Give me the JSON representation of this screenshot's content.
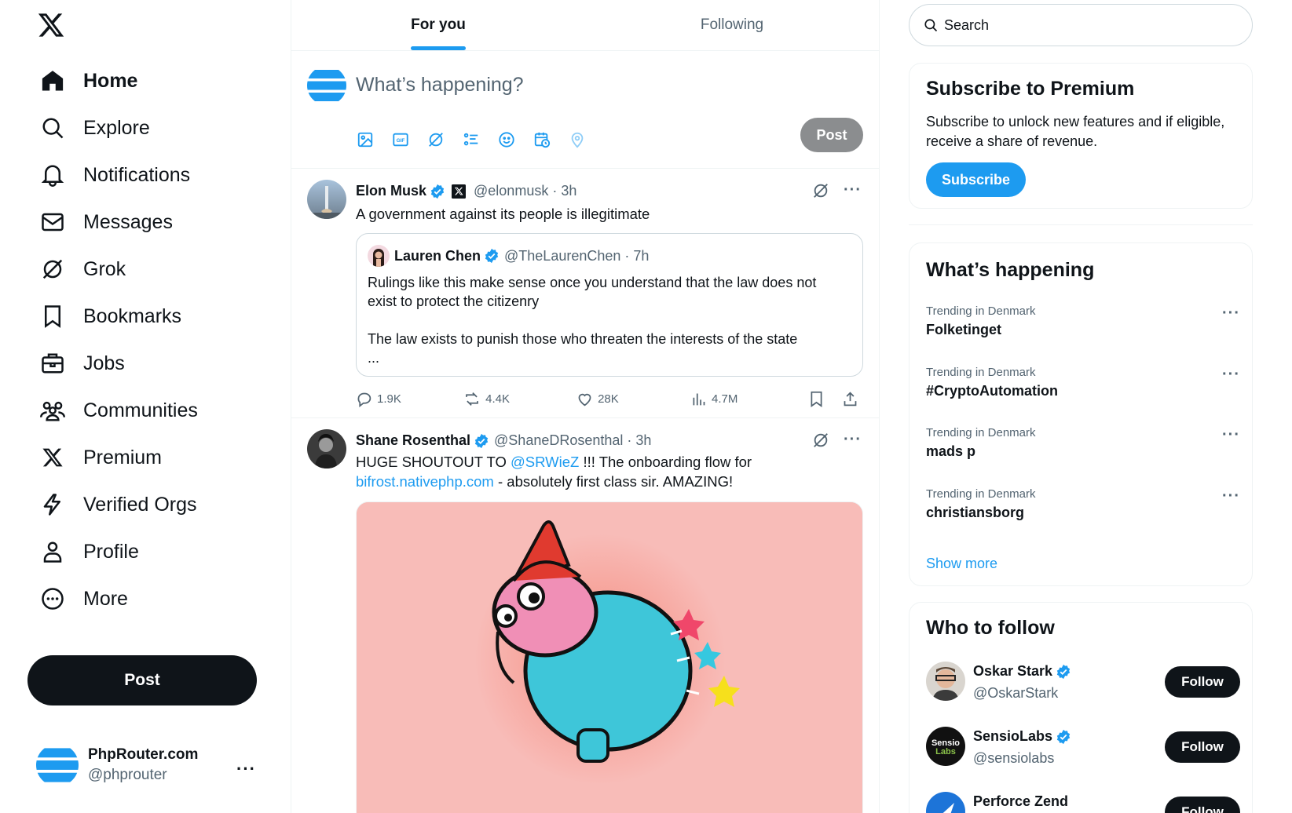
{
  "nav": {
    "items": [
      {
        "label": "Home",
        "icon": "home-icon",
        "active": true
      },
      {
        "label": "Explore",
        "icon": "search-icon"
      },
      {
        "label": "Notifications",
        "icon": "bell-icon"
      },
      {
        "label": "Messages",
        "icon": "envelope-icon"
      },
      {
        "label": "Grok",
        "icon": "grok-icon"
      },
      {
        "label": "Bookmarks",
        "icon": "bookmark-icon"
      },
      {
        "label": "Jobs",
        "icon": "briefcase-icon"
      },
      {
        "label": "Communities",
        "icon": "people-icon"
      },
      {
        "label": "Premium",
        "icon": "x-logo-icon"
      },
      {
        "label": "Verified Orgs",
        "icon": "lightning-icon"
      },
      {
        "label": "Profile",
        "icon": "person-icon"
      },
      {
        "label": "More",
        "icon": "more-circle-icon"
      }
    ],
    "post_label": "Post"
  },
  "account": {
    "name": "PhpRouter.com",
    "handle": "@phprouter",
    "more": "···"
  },
  "tabs": [
    {
      "label": "For you",
      "active": true
    },
    {
      "label": "Following",
      "active": false
    }
  ],
  "composer": {
    "placeholder": "What’s happening?",
    "post_label": "Post"
  },
  "tweets": [
    {
      "name": "Elon Musk",
      "handle": "@elonmusk · 3h",
      "text": "A government against its people is illegitimate",
      "quote": {
        "name": "Lauren Chen",
        "handle": "@TheLaurenChen · 7h",
        "line1": "Rulings like this make sense once you understand that the law does not exist to protect the citizenry",
        "line2": "The law exists to punish those who threaten the interests of the state",
        "line3": "..."
      },
      "replies": "1.9K",
      "reposts": "4.4K",
      "likes": "28K",
      "views": "4.7M"
    },
    {
      "name": "Shane Rosenthal",
      "handle": "@ShaneDRosenthal · 3h",
      "text_a": "HUGE SHOUTOUT TO ",
      "mention": "@SRWieZ",
      "text_b": " !!! The onboarding flow for ",
      "link": "bifrost.nativephp.com",
      "text_c": " - absolutely first class sir. AMAZING!"
    }
  ],
  "search": {
    "placeholder": "Search"
  },
  "premium": {
    "title": "Subscribe to Premium",
    "desc": "Subscribe to unlock new features and if eligible, receive a share of revenue.",
    "button": "Subscribe"
  },
  "happening": {
    "title": "What’s happening",
    "trends": [
      {
        "context": "Trending in Denmark",
        "title": "Folketinget"
      },
      {
        "context": "Trending in Denmark",
        "title": "#CryptoAutomation"
      },
      {
        "context": "Trending in Denmark",
        "title": "mads p"
      },
      {
        "context": "Trending in Denmark",
        "title": "christiansborg"
      }
    ],
    "show_more": "Show more"
  },
  "who_to_follow": {
    "title": "Who to follow",
    "accounts": [
      {
        "name": "Oskar Stark",
        "handle": "@OskarStark",
        "button": "Follow"
      },
      {
        "name": "SensioLabs",
        "handle": "@sensiolabs",
        "button": "Follow"
      },
      {
        "name": "Perforce Zend",
        "handle": "",
        "button": "Follow"
      }
    ]
  },
  "colors": {
    "accent": "#1d9bf0",
    "text": "#0f1419",
    "muted": "#536471"
  }
}
